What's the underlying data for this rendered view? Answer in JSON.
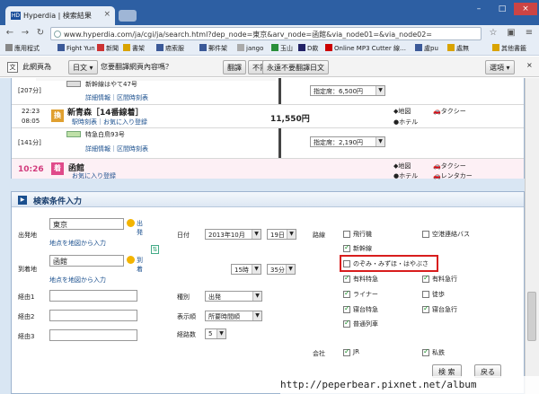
{
  "browser": {
    "tab_title": "Hyperdia | 検索結果",
    "tab_favicon": "HD",
    "url": "www.hyperdia.com/ja/cgi/ja/search.html?dep_node=東京&arv_node=函館&via_node01=&via_node02=",
    "bookmarks": [
      "應用程式",
      "Fight Yun",
      "新聞",
      "書架",
      "癌索服",
      "郵件架",
      "jango",
      "玉山",
      "D款",
      "Online MP3 Cutter 線…",
      "盧pu",
      "處無"
    ],
    "other_bookmarks": "其他書籤"
  },
  "translate_bar": {
    "label": "此網頁為",
    "language": "日文",
    "question": "您要翻譯網頁內容嗎？",
    "translate": "翻譯",
    "nope": "不需要",
    "never": "永遠不要翻譯日文",
    "options": "選項"
  },
  "results": {
    "row1_min": "[207分]",
    "train1": "新幹線はやて47号",
    "train1_links": "詳細情報｜区間時刻表",
    "seat1": "指定席：6,500円",
    "time2_arr": "22:23",
    "time2_dep": "08:05",
    "transfer_mark": "換",
    "station2": "新青森［14番線着］",
    "station2_links": "駅時刻表｜お気に入り登録",
    "fare": "11,550円",
    "map2": "地図",
    "taxi2": "タクシー",
    "hotel2": "ホテル",
    "row3_min": "[141分]",
    "train2": "特急白鳥93号",
    "train2_links": "詳細情報｜区間時刻表",
    "seat2": "指定席：2,190円",
    "arrival_time": "10:26",
    "arrival_mark": "着",
    "station3": "函館",
    "station3_links": "お気に入り登録",
    "map3": "地図",
    "taxi3": "タクシー",
    "hotel3": "ホテル",
    "rentacar3": "レンタカー"
  },
  "form": {
    "title": "検索条件入力",
    "from_label": "出発地",
    "from_value": "東京",
    "from_kind": "出発",
    "map_select": "地点を地図から入力",
    "to_label": "到着地",
    "to_value": "函館",
    "to_kind": "到着",
    "date_label": "日付",
    "year_month": "2013年10月",
    "day": "19日",
    "hour": "15時",
    "minute": "35分",
    "via1": "経由1",
    "via2": "経由2",
    "via3": "経由3",
    "kind_label": "種別",
    "kind_value": "出発",
    "order_label": "表示順",
    "order_value": "所要時間順",
    "transfers_label": "経路数",
    "transfers_value": "5",
    "route_label": "路線",
    "company_label": "会社",
    "search_btn": "検 索",
    "back_btn": "戻る",
    "checks": {
      "airplane": "飛行機",
      "airport_bus": "空港連絡バス",
      "shinkansen": "新幹線",
      "nozomi": "のぞみ・みずほ・はやぶさ",
      "paid_express": "有料特急",
      "paid_rapid": "有料急行",
      "liner": "ライナー",
      "walk": "徒歩",
      "sleeper_express": "寝台特急",
      "sleeper_rapid": "寝台急行",
      "local": "普通列車",
      "jr": "JR",
      "private": "私鉄"
    }
  },
  "watermark": "http://peperbear.pixnet.net/album"
}
